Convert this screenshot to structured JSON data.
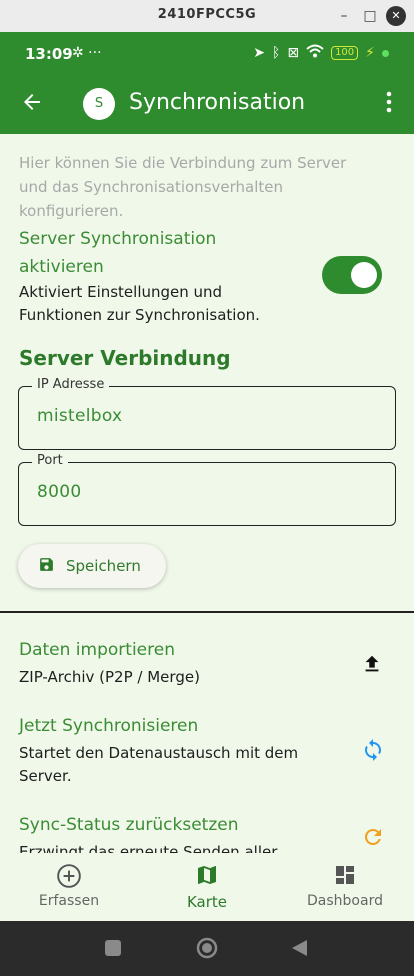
{
  "window": {
    "title": "2410FPCC5G",
    "minimize": "–",
    "maximize": "□",
    "close": "✕"
  },
  "statusbar": {
    "time": "13:09",
    "extra": "✲ ···",
    "battery": "100"
  },
  "appbar": {
    "avatar": "S",
    "title": "Synchronisation"
  },
  "intro": "Hier können Sie die Verbindung zum Server und das Synchronisationsverhalten konfigurieren.",
  "sync": {
    "title": "Server Synchronisation aktivieren",
    "description": "Aktiviert Einstellungen und Funktionen zur Synchronisation.",
    "enabled": true
  },
  "server": {
    "heading": "Server Verbindung",
    "ip_label": "IP Adresse",
    "ip_value": "mistelbox",
    "port_label": "Port",
    "port_value": "8000",
    "save_label": "Speichern"
  },
  "items": [
    {
      "title": "Daten importieren",
      "description": "ZIP-Archiv (P2P / Merge)",
      "icon": "upload-icon"
    },
    {
      "title": "Jetzt Synchronisieren",
      "description": "Startet den Datenaustausch mit dem Server.",
      "icon": "sync-icon"
    },
    {
      "title": "Sync-Status zurücksetzen",
      "description": "Erzwingt das erneute Senden aller Daten",
      "icon": "refresh-icon"
    }
  ],
  "bottom_nav": [
    {
      "label": "Erfassen",
      "icon": "add-circle-icon"
    },
    {
      "label": "Karte",
      "icon": "map-icon",
      "active": true
    },
    {
      "label": "Dashboard",
      "icon": "dashboard-icon"
    }
  ],
  "colors": {
    "primary": "#2e8b2e",
    "accent_text": "#3b8c35",
    "background": "#f0f8ea",
    "sync_icon": "#2196f3",
    "refresh_icon": "#f0a020"
  }
}
